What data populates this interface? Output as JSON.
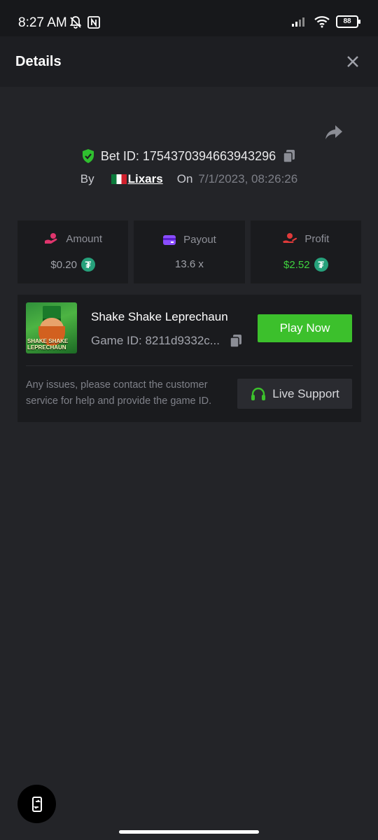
{
  "status_bar": {
    "time": "8:27 AM",
    "battery": "88"
  },
  "header": {
    "title": "Details"
  },
  "bet": {
    "id_label": "Bet ID: 1754370394663943296",
    "by_label": "By",
    "username": "Lixars",
    "on_label": "On",
    "datetime": "7/1/2023, 08:26:26"
  },
  "stats": {
    "amount_label": "Amount",
    "amount_value": "$0.20",
    "payout_label": "Payout",
    "payout_value": "13.6 x",
    "profit_label": "Profit",
    "profit_value": "$2.52"
  },
  "game": {
    "name": "Shake Shake Leprechaun",
    "id_label": "Game ID: 8211d9332c...",
    "thumb_text": "SHAKE SHAKE LEPRECHAUN",
    "play_label": "Play Now",
    "support_text": "Any issues, please contact the customer service for help and provide the game ID.",
    "support_label": "Live Support"
  },
  "colors": {
    "accent_green": "#3cc02c",
    "profit_green": "#3fd23f",
    "amount_icon": "#e0356d",
    "payout_icon": "#8a4dff",
    "profit_icon": "#e03a3a",
    "verified": "#2fbf2f",
    "tether": "#26a17b"
  },
  "icons": {
    "close": "close-icon",
    "share": "share-icon",
    "verified": "shield-check-icon",
    "copy": "copy-icon",
    "amount": "money-hand-icon",
    "payout": "wallet-icon",
    "profit": "profit-hand-icon",
    "currency": "tether-icon",
    "support": "headset-icon",
    "rotate": "rotate-icon"
  }
}
